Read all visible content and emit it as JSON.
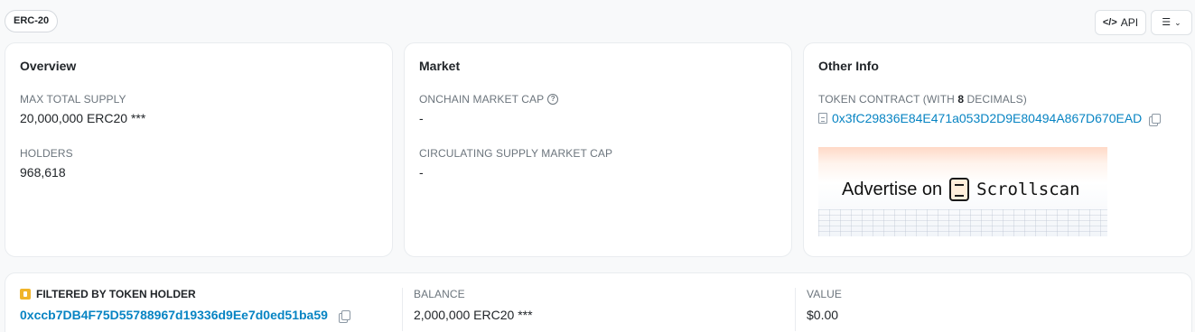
{
  "header": {
    "token_standard": "ERC-20",
    "api_label": "API",
    "api_icon": "code-icon",
    "menu_icon": "list-check-icon"
  },
  "overview": {
    "title": "Overview",
    "max_supply_label": "MAX TOTAL SUPPLY",
    "max_supply_value": "20,000,000 ERC20 ***",
    "holders_label": "HOLDERS",
    "holders_value": "968,618"
  },
  "market": {
    "title": "Market",
    "onchain_cap_label": "ONCHAIN MARKET CAP",
    "onchain_cap_value": "-",
    "circulating_cap_label": "CIRCULATING SUPPLY MARKET CAP",
    "circulating_cap_value": "-"
  },
  "other_info": {
    "title": "Other Info",
    "contract_label_prefix": "TOKEN CONTRACT (WITH ",
    "contract_decimals": "8",
    "contract_label_suffix": " DECIMALS)",
    "contract_address": "0x3fC29836E84E471a053D2D9E80494A867D670EAD",
    "ad_text": "Advertise on",
    "ad_brand": "Scrollscan"
  },
  "filter": {
    "holder_label": "FILTERED BY TOKEN HOLDER",
    "holder_address": "0xccb7DB4F75D55788967d19336d9Ee7d0ed51ba59",
    "balance_label": "BALANCE",
    "balance_value": "2,000,000 ERC20 ***",
    "value_label": "VALUE",
    "value_value": "$0.00"
  },
  "colors": {
    "link": "#0784c3",
    "muted": "#6c757d",
    "holder_icon": "#f0b429"
  }
}
